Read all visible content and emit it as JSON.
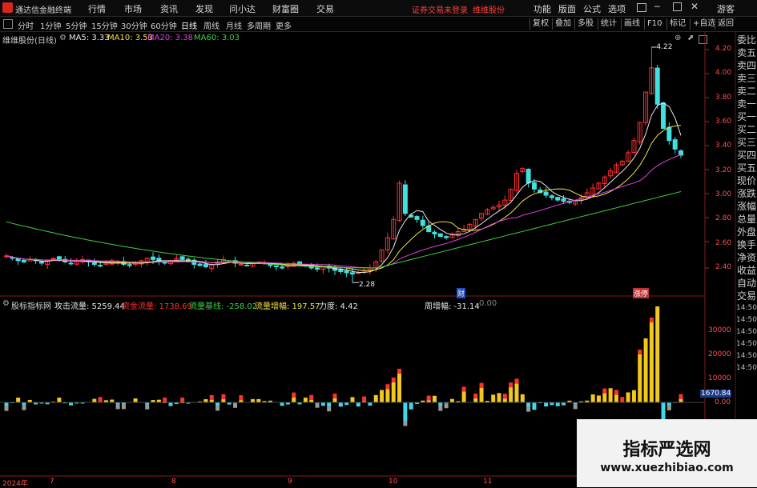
{
  "topbar": {
    "app_name": "通达信金融终端",
    "menus": [
      "行情",
      "市场",
      "资讯",
      "发现",
      "问小达",
      "财富圈",
      "交易"
    ],
    "login_msg": "证券交易未登录",
    "stock_link": "维维股份",
    "right_menus": [
      "功能",
      "版面",
      "公式",
      "选项"
    ],
    "guest": "游客"
  },
  "toolbar": {
    "periods": [
      "分时",
      "1分钟",
      "5分钟",
      "15分钟",
      "30分钟",
      "60分钟",
      "日线",
      "周线",
      "月线",
      "多周期",
      "更多"
    ],
    "active_period": "日线",
    "right_tools": [
      "复权",
      "叠加",
      "多股",
      "统计",
      "画线",
      "F10",
      "标记",
      "+自选",
      "返回"
    ]
  },
  "main_legend": {
    "title": "维维股份(日线)",
    "ma": [
      {
        "label": "MA5: 3.33",
        "color": "#e8e8e8"
      },
      {
        "label": "MA10: 3.53",
        "color": "#f2e14a"
      },
      {
        "label": "MA20: 3.38",
        "color": "#e040e0"
      },
      {
        "label": "MA60: 3.03",
        "color": "#40d040"
      }
    ]
  },
  "price_axis": [
    "4.20",
    "4.00",
    "3.80",
    "3.60",
    "3.40",
    "3.20",
    "3.00",
    "2.80",
    "2.60",
    "2.40"
  ],
  "annotations": {
    "high": "4.22",
    "low": "2.28",
    "mark1": "财",
    "mark2": "涨停"
  },
  "sidebar": [
    "委比",
    "卖五",
    "卖四",
    "卖三",
    "卖二",
    "卖一",
    "买一",
    "买二",
    "买三",
    "买四",
    "买五",
    "现价",
    "涨跌",
    "涨幅",
    "总量",
    "外盘",
    "换手",
    "净资",
    "收益",
    "自动",
    "交易",
    "14:50",
    "14:50",
    "14:50",
    "14:50",
    "14:50",
    "14:50"
  ],
  "indicator": {
    "name": "股标指标网",
    "items": [
      {
        "label": "攻击流量: 5259.44",
        "color": "#e8e8e8"
      },
      {
        "label": "资金流量: 1738.69",
        "color": "#ff3030"
      },
      {
        "label": "流量基线: -258.02",
        "color": "#40d040"
      },
      {
        "label": "流量增幅: 197.57",
        "color": "#f2e14a"
      },
      {
        "label": "力度: 4.42",
        "color": "#e8e8e8"
      },
      {
        "label": "周增幅: -31.14",
        "color": "#e8e8e8"
      },
      {
        "label": "0.00",
        "color": "#888888"
      }
    ],
    "axis": [
      "30000",
      "20000",
      "10000",
      "0.00"
    ],
    "current_value": "1670.84"
  },
  "xaxis": [
    "2024年",
    "7",
    "8",
    "9",
    "10",
    "11"
  ],
  "watermark": {
    "title": "指标严选网",
    "url": "www.xuezhibiao.com"
  },
  "colors": {
    "up": "#ff3030",
    "down": "#40e0e0",
    "ma5": "#e8e8e8",
    "ma10": "#f2e14a",
    "ma20": "#e040e0",
    "ma60": "#40d040",
    "vol_up": "#f2c81e",
    "vol_dn": "#40d8e8",
    "vol_gray": "#9a9a9a"
  },
  "chart_data": {
    "type": "candlestick",
    "title": "维维股份(日线)",
    "ylim": [
      2.28,
      4.22
    ],
    "series": [
      {
        "name": "MA5",
        "last": 3.33
      },
      {
        "name": "MA10",
        "last": 3.53
      },
      {
        "name": "MA20",
        "last": 3.38
      },
      {
        "name": "MA60",
        "last": 3.03
      }
    ],
    "closes": [
      2.5,
      2.48,
      2.46,
      2.45,
      2.47,
      2.46,
      2.44,
      2.46,
      2.48,
      2.47,
      2.45,
      2.44,
      2.46,
      2.47,
      2.45,
      2.43,
      2.42,
      2.44,
      2.46,
      2.45,
      2.43,
      2.42,
      2.44,
      2.46,
      2.48,
      2.47,
      2.45,
      2.44,
      2.46,
      2.48,
      2.47,
      2.45,
      2.43,
      2.42,
      2.41,
      2.43,
      2.45,
      2.47,
      2.46,
      2.44,
      2.43,
      2.42,
      2.44,
      2.45,
      2.44,
      2.42,
      2.41,
      2.4,
      2.42,
      2.44,
      2.43,
      2.42,
      2.4,
      2.39,
      2.41,
      2.4,
      2.38,
      2.37,
      2.36,
      2.35,
      2.36,
      2.38,
      2.4,
      2.45,
      2.55,
      2.65,
      2.8,
      3.1,
      2.85,
      2.82,
      2.8,
      2.75,
      2.7,
      2.68,
      2.66,
      2.65,
      2.68,
      2.7,
      2.72,
      2.76,
      2.8,
      2.85,
      2.88,
      2.9,
      2.92,
      2.96,
      3.05,
      3.18,
      3.22,
      3.1,
      3.05,
      3.02,
      3.0,
      2.98,
      2.96,
      2.95,
      2.94,
      2.95,
      2.98,
      3.02,
      3.06,
      3.1,
      3.15,
      3.2,
      3.25,
      3.28,
      3.35,
      3.45,
      3.6,
      3.85,
      4.05,
      3.75,
      3.55,
      3.45,
      3.38,
      3.33
    ]
  }
}
